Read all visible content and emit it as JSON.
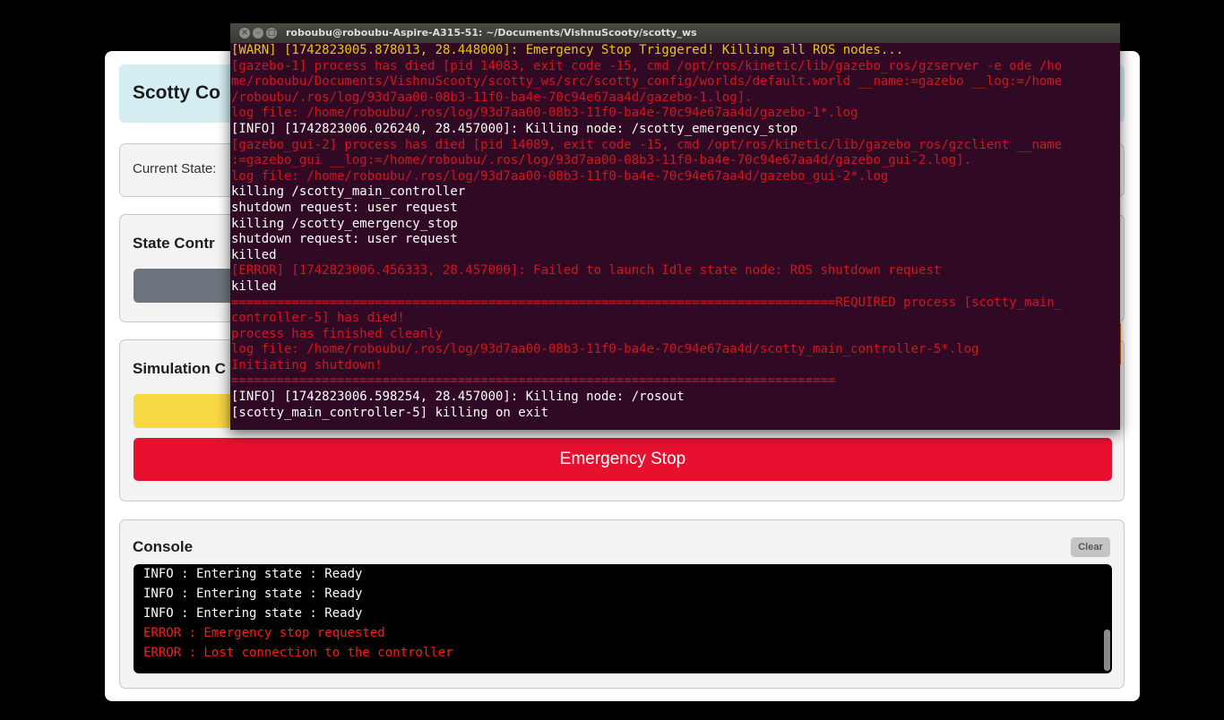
{
  "app": {
    "title": "Scotty Co",
    "current_state_label": "Current State:",
    "state_control_title": "State Contr",
    "simulation_title": "Simulation C",
    "emergency_stop_label": "Emergency Stop",
    "console_title": "Console",
    "clear_label": "Clear",
    "console_lines": [
      {
        "text": "INFO : Entering state : Ready",
        "level": "info"
      },
      {
        "text": "INFO : Entering state : Ready",
        "level": "info"
      },
      {
        "text": "INFO : Entering state : Ready",
        "level": "info"
      },
      {
        "text": "ERROR : Emergency stop requested",
        "level": "error"
      },
      {
        "text": "ERROR : Lost connection to the controller",
        "level": "error"
      }
    ]
  },
  "terminal": {
    "title": "roboubu@roboubu-Aspire-A315-51: ~/Documents/VishnuScooty/scotty_ws",
    "lines": [
      {
        "text": "[WARN] [1742823005.878013, 28.448000]: Emergency Stop Triggered! Killing all ROS nodes...",
        "level": "warn"
      },
      {
        "text": "[gazebo-1] process has died [pid 14083, exit code -15, cmd /opt/ros/kinetic/lib/gazebo_ros/gzserver -e ode /ho",
        "level": "error"
      },
      {
        "text": "me/roboubu/Documents/VishnuScooty/scotty_ws/src/scotty_config/worlds/default.world __name:=gazebo __log:=/home",
        "level": "error"
      },
      {
        "text": "/roboubu/.ros/log/93d7aa00-08b3-11f0-ba4e-70c94e67aa4d/gazebo-1.log].",
        "level": "error"
      },
      {
        "text": "log file: /home/roboubu/.ros/log/93d7aa00-08b3-11f0-ba4e-70c94e67aa4d/gazebo-1*.log",
        "level": "error"
      },
      {
        "text": "[INFO] [1742823006.026240, 28.457000]: Killing node: /scotty_emergency_stop",
        "level": "info"
      },
      {
        "text": "[gazebo_gui-2] process has died [pid 14089, exit code -15, cmd /opt/ros/kinetic/lib/gazebo_ros/gzclient __name",
        "level": "error"
      },
      {
        "text": ":=gazebo_gui __log:=/home/roboubu/.ros/log/93d7aa00-08b3-11f0-ba4e-70c94e67aa4d/gazebo_gui-2.log].",
        "level": "error"
      },
      {
        "text": "log file: /home/roboubu/.ros/log/93d7aa00-08b3-11f0-ba4e-70c94e67aa4d/gazebo_gui-2*.log",
        "level": "error"
      },
      {
        "text": "killing /scotty_main_controller",
        "level": "info"
      },
      {
        "text": "shutdown request: user request",
        "level": "info"
      },
      {
        "text": "killing /scotty_emergency_stop",
        "level": "info"
      },
      {
        "text": "shutdown request: user request",
        "level": "info"
      },
      {
        "text": "killed",
        "level": "info"
      },
      {
        "text": "[ERROR] [1742823006.456333, 28.457000]: Failed to launch Idle state node: ROS shutdown request",
        "level": "error"
      },
      {
        "text": "killed",
        "level": "info"
      },
      {
        "text": "================================================================================REQUIRED process [scotty_main_",
        "level": "error"
      },
      {
        "text": "controller-5] has died!",
        "level": "error"
      },
      {
        "text": "process has finished cleanly",
        "level": "error"
      },
      {
        "text": "log file: /home/roboubu/.ros/log/93d7aa00-08b3-11f0-ba4e-70c94e67aa4d/scotty_main_controller-5*.log",
        "level": "error"
      },
      {
        "text": "Initiating shutdown!",
        "level": "error"
      },
      {
        "text": "================================================================================",
        "level": "error"
      },
      {
        "text": "[INFO] [1742823006.598254, 28.457000]: Killing node: /rosout",
        "level": "info"
      },
      {
        "text": "[scotty_main_controller-5] killing on exit",
        "level": "info"
      }
    ]
  },
  "colors": {
    "terminal_bg": "#300a24",
    "terminal_info": "#ffffff",
    "terminal_warn": "#e6c619",
    "terminal_error": "#d2161e",
    "console_info": "#ffffff",
    "console_error": "#ff1a1a",
    "emergency_red": "#e8102f",
    "simulation_yellow": "#f8d845",
    "header_bg": "#d5eef2"
  }
}
